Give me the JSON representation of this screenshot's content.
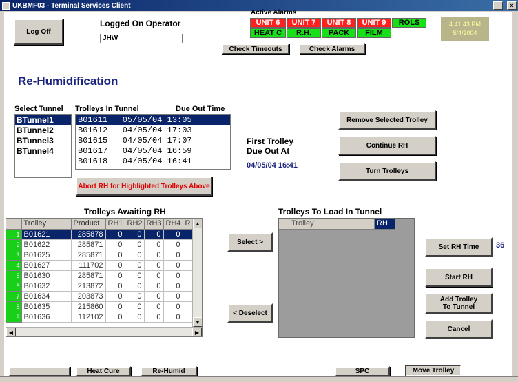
{
  "window": {
    "title": "UKBMF03 - Terminal Services Client",
    "controls": [
      "_",
      "□",
      "×"
    ]
  },
  "header": {
    "logoff_label": "Log Off",
    "operator_label": "Logged On Operator",
    "operator_value": "JHW",
    "alarms_title": "Active Alarms",
    "alarms_row1": [
      {
        "label": "UNIT 6",
        "color": "red"
      },
      {
        "label": "UNIT 7",
        "color": "red"
      },
      {
        "label": "UNIT 8",
        "color": "red"
      },
      {
        "label": "UNIT 9",
        "color": "red"
      },
      {
        "label": "ROLS",
        "color": "green"
      }
    ],
    "alarms_row2": [
      {
        "label": "HEAT C",
        "color": "green"
      },
      {
        "label": "R.H.",
        "color": "green"
      },
      {
        "label": "PACK",
        "color": "green"
      },
      {
        "label": "FILM",
        "color": "green"
      }
    ],
    "check_timeouts_label": "Check Timeouts",
    "check_alarms_label": "Check Alarms",
    "clock_time": "4:41:43 PM",
    "clock_date": "5/4/2004"
  },
  "page_title": "Re-Humidification",
  "tunnels": {
    "label": "Select Tunnel",
    "items": [
      "BTunnel1",
      "BTunnel2",
      "BTunnel3",
      "BTunnel4"
    ],
    "selected": 0
  },
  "trolleys_in_tunnel": {
    "label": "Trolleys In Tunnel",
    "due_label": "Due Out Time",
    "rows": [
      "B01611   05/05/04 13:05",
      "B01612   04/05/04 17:03",
      "B01615   04/05/04 17:07",
      "B01617   04/05/04 16:59",
      "B01618   04/05/04 16:41"
    ],
    "selected": 0,
    "abort_label": "Abort RH for Highlighted Trolleys Above"
  },
  "first_trolley": {
    "label_line1": "First Trolley",
    "label_line2": "Due Out At",
    "value": "04/05/04 16:41"
  },
  "actions": {
    "remove_label": "Remove Selected Trolley",
    "continue_label": "Continue RH",
    "turn_label": "Turn Trolleys"
  },
  "awaiting": {
    "title": "Trolleys Awaiting RH",
    "columns": [
      "Trolley",
      "Product",
      "RH1",
      "RH2",
      "RH3",
      "RH4",
      "R"
    ],
    "rows": [
      [
        "1",
        "B01621",
        "285878",
        "0",
        "0",
        "0",
        "0"
      ],
      [
        "2",
        "B01622",
        "285871",
        "0",
        "0",
        "0",
        "0"
      ],
      [
        "3",
        "B01625",
        "285871",
        "0",
        "0",
        "0",
        "0"
      ],
      [
        "4",
        "B01627",
        "111702",
        "0",
        "0",
        "0",
        "0"
      ],
      [
        "5",
        "B01630",
        "285871",
        "0",
        "0",
        "0",
        "0"
      ],
      [
        "6",
        "B01632",
        "213872",
        "0",
        "0",
        "0",
        "0"
      ],
      [
        "7",
        "B01634",
        "203873",
        "0",
        "0",
        "0",
        "0"
      ],
      [
        "8",
        "B01635",
        "215860",
        "0",
        "0",
        "0",
        "0"
      ],
      [
        "9",
        "B01636",
        "112102",
        "0",
        "0",
        "0",
        "0"
      ]
    ],
    "selected": 0
  },
  "transfer": {
    "select_label": "Select >",
    "deselect_label": "< Deselect"
  },
  "to_load": {
    "title": "Trolleys To Load In Tunnel",
    "columns": [
      "Trolley",
      "RH"
    ]
  },
  "rh_controls": {
    "set_rh_time_label": "Set RH Time",
    "rh_time_value": "36",
    "start_rh_label": "Start RH",
    "add_trolley_label_line1": "Add Trolley",
    "add_trolley_label_line2": "To Tunnel",
    "cancel_label": "Cancel"
  },
  "footer": {
    "heat_cure_label": "Heat Cure",
    "re_humid_label": "Re-Humid",
    "spc_label": "SPC",
    "move_trolley_label": "Move Trolley"
  },
  "colors": {
    "selection": "#0a246a",
    "alarm_red": "#ff2020",
    "alarm_green": "#18e018",
    "title_blue": "#1a237e",
    "abort_red": "#e00000"
  }
}
